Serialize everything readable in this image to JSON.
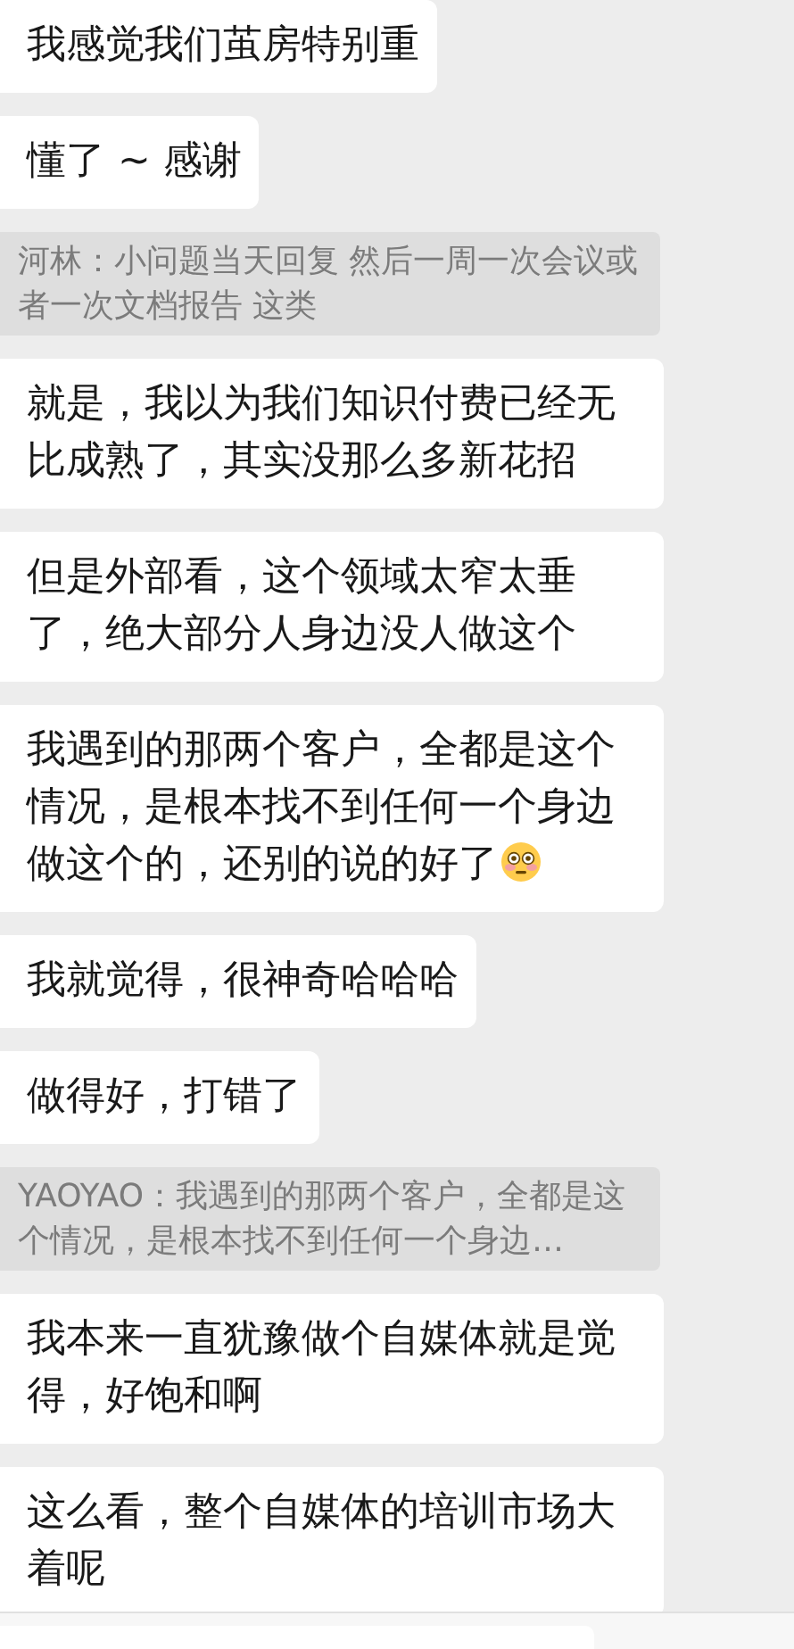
{
  "messages": [
    {
      "kind": "text",
      "text": "我感觉我们茧房特别重"
    },
    {
      "kind": "text",
      "text": "懂了 ~ 感谢"
    },
    {
      "kind": "quote",
      "text": "河林：小问题当天回复  然后一周一次会议或者一次文档报告 这类"
    },
    {
      "kind": "text",
      "text": "就是，我以为我们知识付费已经无比成熟了，其实没那么多新花招"
    },
    {
      "kind": "text",
      "text": "但是外部看，这个领域太窄太垂了，绝大部分人身边没人做这个"
    },
    {
      "kind": "text",
      "text": "我遇到的那两个客户，全都是这个情况，是根本找不到任何一个身边做这个的，还别的说的好了",
      "emoji": true
    },
    {
      "kind": "text",
      "text": "我就觉得，很神奇哈哈哈"
    },
    {
      "kind": "text",
      "text": "做得好，打错了"
    },
    {
      "kind": "quote",
      "text": "YAOYAO：我遇到的那两个客户，全都是这个情况，是根本找不到任何一个身边…"
    },
    {
      "kind": "text",
      "text": "我本来一直犹豫做个自媒体就是觉得，好饱和啊"
    },
    {
      "kind": "text",
      "text": "这么看，整个自媒体的培训市场大着呢"
    }
  ],
  "input_bar": {
    "kind": "text"
  }
}
